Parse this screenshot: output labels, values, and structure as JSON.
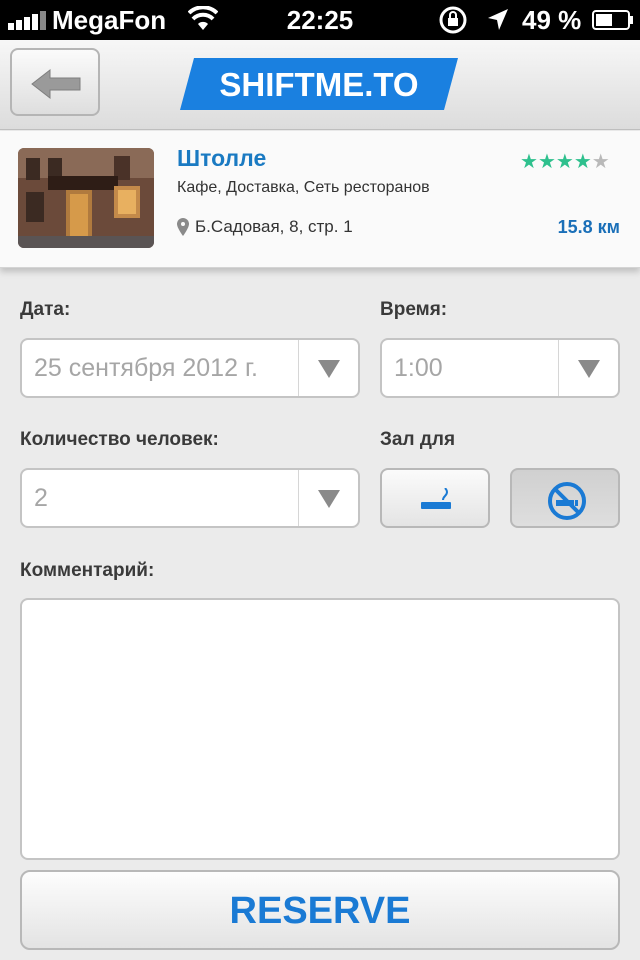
{
  "status_bar": {
    "carrier": "MegaFon",
    "time": "22:25",
    "battery_percent": "49 %"
  },
  "header": {
    "logo_text": "SHIFTME.TO",
    "back_icon": "back-arrow-icon"
  },
  "venue": {
    "name": "Штолле",
    "categories": "Кафе, Доставка, Сеть ресторанов",
    "address": "Б.Садовая, 8, стр. 1",
    "distance": "15.8 км",
    "rating": 3.5,
    "rating_max": 5
  },
  "form": {
    "date_label": "Дата:",
    "date_value": "25 сентября 2012 г.",
    "time_label": "Время:",
    "time_value": "1:00",
    "people_label": "Количество человек:",
    "people_value": "2",
    "hall_label": "Зал для",
    "smoking_icon": "smoking-icon",
    "no_smoking_icon": "no-smoking-icon",
    "selected_hall": "no-smoking",
    "comment_label": "Комментарий:",
    "comment_value": ""
  },
  "reserve_label": "RESERVE",
  "colors": {
    "accent": "#1a7ad4",
    "stars": "#2ec08d",
    "logo_bg": "#1a80e0"
  }
}
